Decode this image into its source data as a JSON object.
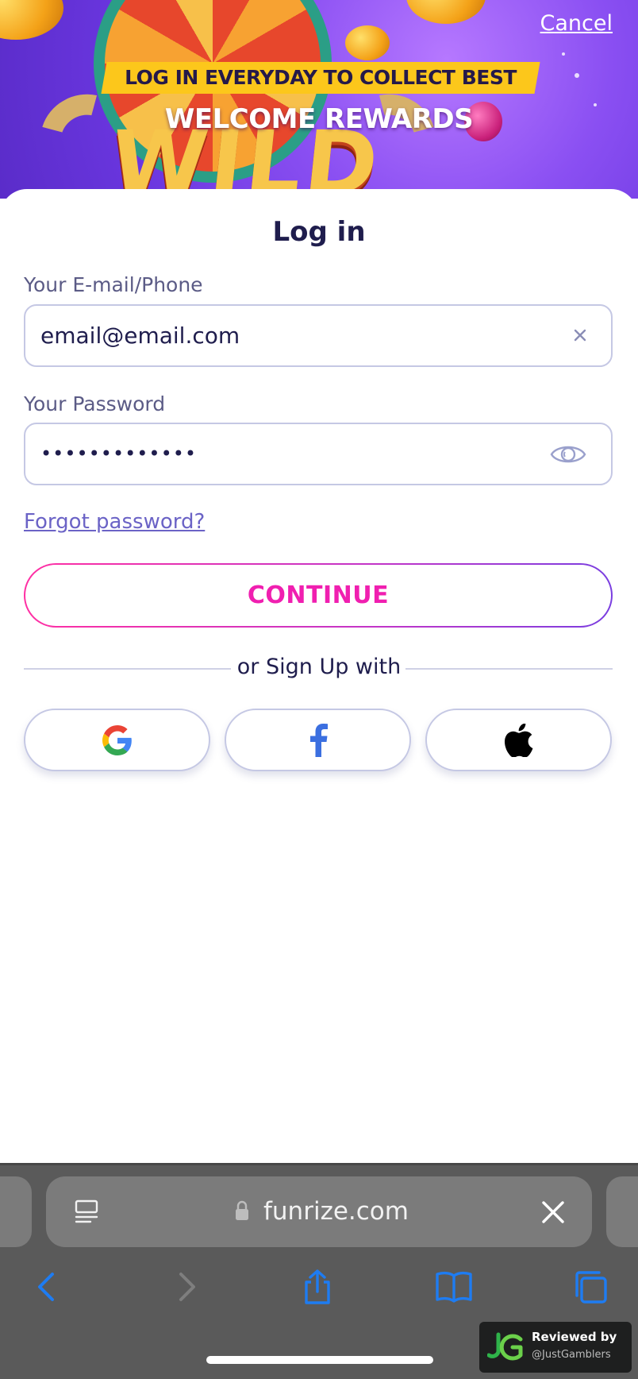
{
  "banner": {
    "cancel_label": "Cancel",
    "promo_line1": "LOG IN EVERYDAY TO COLLECT BEST",
    "promo_line2": "WELCOME REWARDS",
    "art_text": "WILD"
  },
  "login": {
    "title": "Log in",
    "email_label": "Your E-mail/Phone",
    "email_value": "email@email.com",
    "password_label": "Your Password",
    "password_value": "•••••••••••••",
    "forgot_label": "Forgot password?",
    "continue_label": "CONTINUE",
    "divider_text": "or Sign Up with",
    "social_buttons": [
      "google-icon",
      "facebook-icon",
      "apple-icon"
    ]
  },
  "browser": {
    "url": "funrize.com"
  },
  "badge": {
    "line1": "Reviewed by",
    "line2": "@JustGamblers"
  },
  "colors": {
    "accent_pink": "#f01fb0",
    "text_dark": "#1f1d4d",
    "link": "#6b63c6",
    "ios_blue": "#1e7cf2"
  }
}
